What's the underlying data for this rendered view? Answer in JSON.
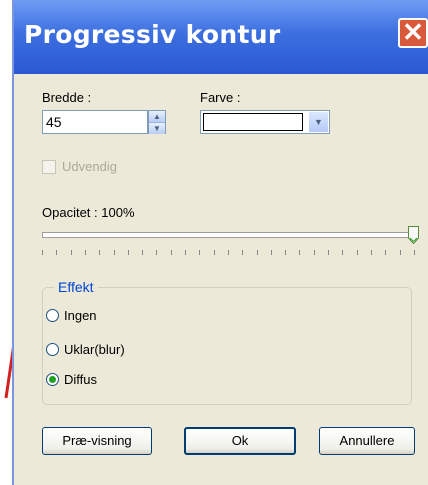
{
  "window": {
    "title": "Progressiv kontur"
  },
  "width": {
    "label": "Bredde :",
    "value": "45"
  },
  "color": {
    "label": "Farve :",
    "swatch": "#ffffff"
  },
  "outside": {
    "label": "Udvendig",
    "checked": false,
    "enabled": false
  },
  "opacity": {
    "label": "Opacitet : 100%",
    "value": 100
  },
  "effect": {
    "legend": "Effekt",
    "options": [
      {
        "label": "Ingen",
        "selected": false
      },
      {
        "label": "Uklar(blur)",
        "selected": false
      },
      {
        "label": "Diffus",
        "selected": true
      }
    ]
  },
  "buttons": {
    "preview": "Præ-visning",
    "ok": "Ok",
    "cancel": "Annullere"
  },
  "colors": {
    "title_bar": "#2a58d2",
    "dialog_bg": "#ece9d8",
    "close": "#d9593b",
    "arrow": "#d42020",
    "radio_selected": "#21a121"
  }
}
